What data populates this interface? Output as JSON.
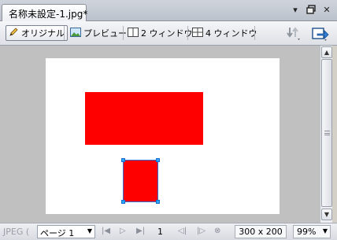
{
  "document": {
    "tab_title": "名称未設定-1.jpg*"
  },
  "window_controls": {
    "menu_icon": "chevron-down-icon",
    "restore_icon": "restore-icon",
    "close_icon": "close-icon"
  },
  "toolbar": {
    "modes": [
      {
        "label": "オリジナル",
        "icon": "pencil-icon",
        "active": true
      },
      {
        "label": "プレビュー",
        "icon": "image-icon",
        "active": false
      },
      {
        "label": "2 ウィンドウ",
        "icon": "two-pane-icon",
        "active": false
      },
      {
        "label": "4 ウィンドウ",
        "icon": "four-pane-icon",
        "active": false
      }
    ],
    "right_icons": [
      "quick-export-icon",
      "export-icon"
    ]
  },
  "canvas": {
    "background_color": "#ffffff",
    "shape_color": "#ff0000",
    "selection_color": "#29a8ff"
  },
  "status": {
    "format_label": "JPEG (",
    "page_select": "ページ 1",
    "frame_number": "1",
    "dimensions": "300 x 200",
    "zoom": "99%"
  }
}
